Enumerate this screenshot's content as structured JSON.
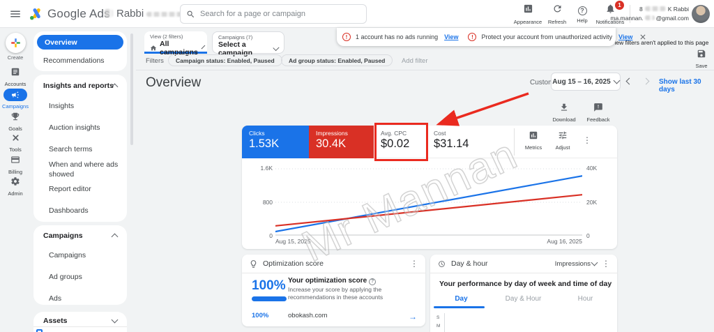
{
  "topbar": {
    "brand": "Google Ads",
    "account_name": "Rabbi",
    "search": {
      "placeholder": "Search for a page or campaign"
    },
    "appearance_label": "Appearance",
    "refresh_label": "Refresh",
    "help_label": "Help",
    "help_glyph": "?",
    "notifications_label": "Notifications",
    "notifications_badge": "1",
    "profile": {
      "id_prefix": "8",
      "name": "K Rabbi",
      "email_prefix": "ma.mannan.",
      "email_suffix": "@gmail.com"
    }
  },
  "rail": {
    "create": "Create",
    "items": [
      {
        "label": "Accounts"
      },
      {
        "label": "Campaigns"
      },
      {
        "label": "Goals"
      },
      {
        "label": "Tools"
      },
      {
        "label": "Billing"
      },
      {
        "label": "Admin"
      }
    ]
  },
  "sidebar": {
    "overview": "Overview",
    "recommendations": "Recommendations",
    "insights_section": {
      "label": "Insights and reports",
      "items": [
        "Insights",
        "Auction insights",
        "Search terms",
        "When and where ads showed",
        "Report editor",
        "Dashboards"
      ]
    },
    "campaigns_section": {
      "label": "Campaigns",
      "items": [
        "Campaigns",
        "Ad groups",
        "Ads"
      ]
    },
    "assets_label": "Assets"
  },
  "selectors": {
    "view": {
      "label": "View (2 filters)",
      "value": "All campaigns"
    },
    "campaign": {
      "label": "Campaigns (7)",
      "value": "Select a campaign"
    }
  },
  "alerts": {
    "a1_text": "1 account has no ads running",
    "a1_link": "View",
    "a2_text": "Protect your account from unauthorized activity",
    "a2_link": "View",
    "note": "View filters aren't applied to this page"
  },
  "filters": {
    "label": "Filters",
    "chip1": "Campaign status: Enabled, Paused",
    "chip2": "Ad group status: Enabled, Paused",
    "add": "Add filter",
    "save": "Save"
  },
  "header": {
    "title": "Overview",
    "custom": "Custom",
    "date_range": "Aug 15 – 16, 2025",
    "show_last": "Show last 30 days",
    "download": "Download",
    "feedback": "Feedback"
  },
  "scorecards": {
    "clicks_label": "Clicks",
    "clicks_value": "1.53K",
    "impressions_label": "Impressions",
    "impressions_value": "30.4K",
    "cpc_label": "Avg. CPC",
    "cpc_value": "$0.02",
    "cost_label": "Cost",
    "cost_value": "$31.14",
    "metrics_label": "Metrics",
    "adjust_label": "Adjust"
  },
  "chart_data": {
    "type": "line",
    "x": [
      "Aug 15, 2025",
      "Aug 16, 2025"
    ],
    "series": [
      {
        "name": "Clicks",
        "axis": "left",
        "color": "#1a73e8",
        "values": [
          100,
          1430
        ]
      },
      {
        "name": "Impressions",
        "axis": "right",
        "color": "#d93025",
        "values": [
          5900,
          24500
        ]
      }
    ],
    "left_axis": {
      "ticks": [
        "1.6K",
        "800",
        "0"
      ],
      "min": 0,
      "max": 1600
    },
    "right_axis": {
      "ticks": [
        "40K",
        "20K",
        "0"
      ],
      "min": 0,
      "max": 40000
    },
    "grid": "dotted-horizontal",
    "legend_position": "none"
  },
  "watermark": "Mr Mannan",
  "annotation": {
    "color": "#ea2a1f",
    "target": "Avg. CPC card"
  },
  "optimization": {
    "header": "Optimization score",
    "score": "100%",
    "title": "Your optimization score",
    "info_glyph": "?",
    "description": "Increase your score by applying the recommendations in these accounts",
    "row_score": "100%",
    "row_domain": "obokash.com",
    "row_arrow": "→"
  },
  "dayhour": {
    "header": "Day & hour",
    "metric": "Impressions",
    "title": "Your performance by day of week and time of day",
    "tabs": [
      "Day",
      "Day & Hour",
      "Hour"
    ],
    "active_tab": "Day",
    "axis_letters": [
      "S",
      "M"
    ]
  }
}
